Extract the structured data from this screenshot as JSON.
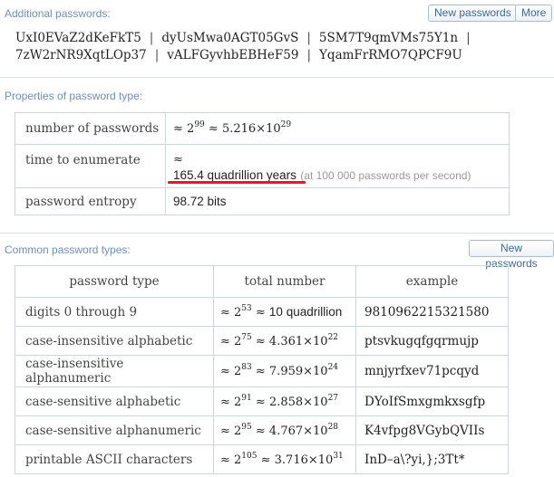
{
  "additional": {
    "title": "Additional passwords:",
    "new_button": "New passwords",
    "more_button": "More",
    "row1": [
      "UxI0EVaZ2dKeFkT5",
      "dyUsMwa0AGT05GvS",
      "5SM7T9qmVMs75Y1n"
    ],
    "row2": [
      "7zW2rNR9XqtLOp37",
      "vALFGyvhbEBHeF59",
      "YqamFrRMO7QPCF9U"
    ],
    "separator": "|"
  },
  "properties": {
    "title": "Properties of password type:",
    "rows": {
      "number": {
        "label": "number of passwords",
        "approx": "≈",
        "base": "2",
        "exp": "99",
        "mantissa": "5.216",
        "times": "×",
        "ten": "10",
        "exp10": "29"
      },
      "time": {
        "label": "time to enumerate",
        "approx": "≈",
        "value": "165.4 quadrillion years",
        "note": "(at 100 000 passwords per second)"
      },
      "entropy": {
        "label": "password entropy",
        "value": "98.72 bits"
      }
    }
  },
  "common": {
    "title": "Common password types:",
    "new_button": "New passwords",
    "headers": [
      "password type",
      "total number",
      "example"
    ],
    "rows": [
      {
        "type": "digits 0 through 9",
        "exp": "53",
        "approx_text": "10 quadrillion",
        "example": "9810962215321580"
      },
      {
        "type": "case-insensitive alphabetic",
        "exp": "75",
        "mantissa": "4.361",
        "exp10": "22",
        "example": "ptsvkugqfgqrmujp"
      },
      {
        "type": "case-insensitive alphanumeric",
        "exp": "83",
        "mantissa": "7.959",
        "exp10": "24",
        "example": "mnjyrfxev71pcqyd"
      },
      {
        "type": "case-sensitive alphabetic",
        "exp": "91",
        "mantissa": "2.858",
        "exp10": "27",
        "example": "DYoIfSmxgmkxsgfp"
      },
      {
        "type": "case-sensitive alphanumeric",
        "exp": "95",
        "mantissa": "4.767",
        "exp10": "28",
        "example": "K4vfpg8VGybQVIIs"
      },
      {
        "type": "printable ASCII characters",
        "exp": "105",
        "mantissa": "3.716",
        "exp10": "31",
        "example": "InD–a\\?yi,};3Tt*"
      }
    ]
  },
  "colors": {
    "section_title": "#6f8fb3",
    "button_text": "#3a6aa0",
    "table_border": "#cfd4d9",
    "highlight_underline": "#dd1e1e"
  }
}
